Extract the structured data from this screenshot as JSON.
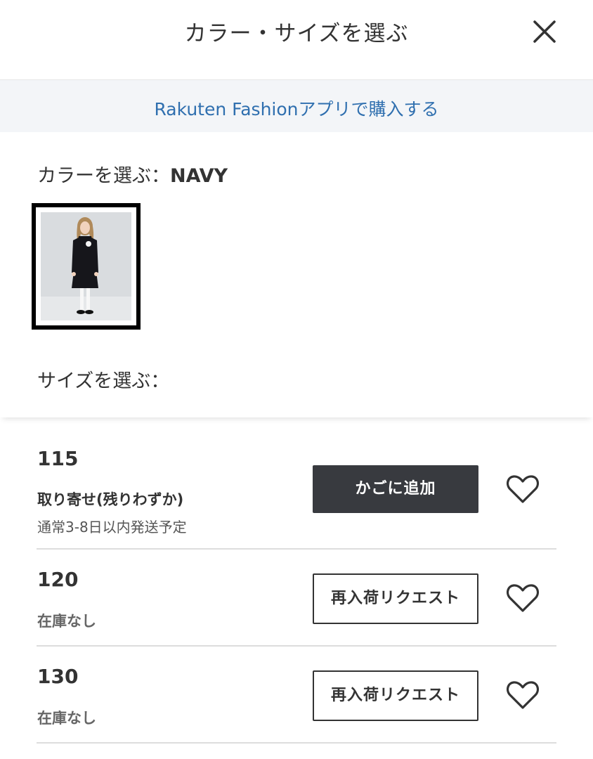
{
  "header": {
    "title": "カラー・サイズを選ぶ",
    "close_icon": "close-icon"
  },
  "app_banner": {
    "link_text": "Rakuten Fashionアプリで購入する",
    "link_color": "#2f6faf"
  },
  "color": {
    "heading": "カラーを選ぶ：",
    "selected_value": "NAVY",
    "swatches": [
      {
        "name": "NAVY",
        "selected": true
      }
    ]
  },
  "size": {
    "heading": "サイズを選ぶ：",
    "options": [
      {
        "label": "115",
        "status": "取り寄せ(残りわずか)",
        "shipping_note": "通常3-8日以内発送予定",
        "action": "かごに追加",
        "action_type": "add-to-cart"
      },
      {
        "label": "120",
        "status": "在庫なし",
        "action": "再入荷リクエスト",
        "action_type": "restock-request"
      },
      {
        "label": "130",
        "status": "在庫なし",
        "action": "再入荷リクエスト",
        "action_type": "restock-request"
      }
    ]
  },
  "icons": {
    "favorite": "heart-outline-icon"
  },
  "colors": {
    "primary_button": "#383a3f",
    "text": "#333333",
    "banner_bg": "#f3f5f8",
    "divider": "#dddddd"
  }
}
